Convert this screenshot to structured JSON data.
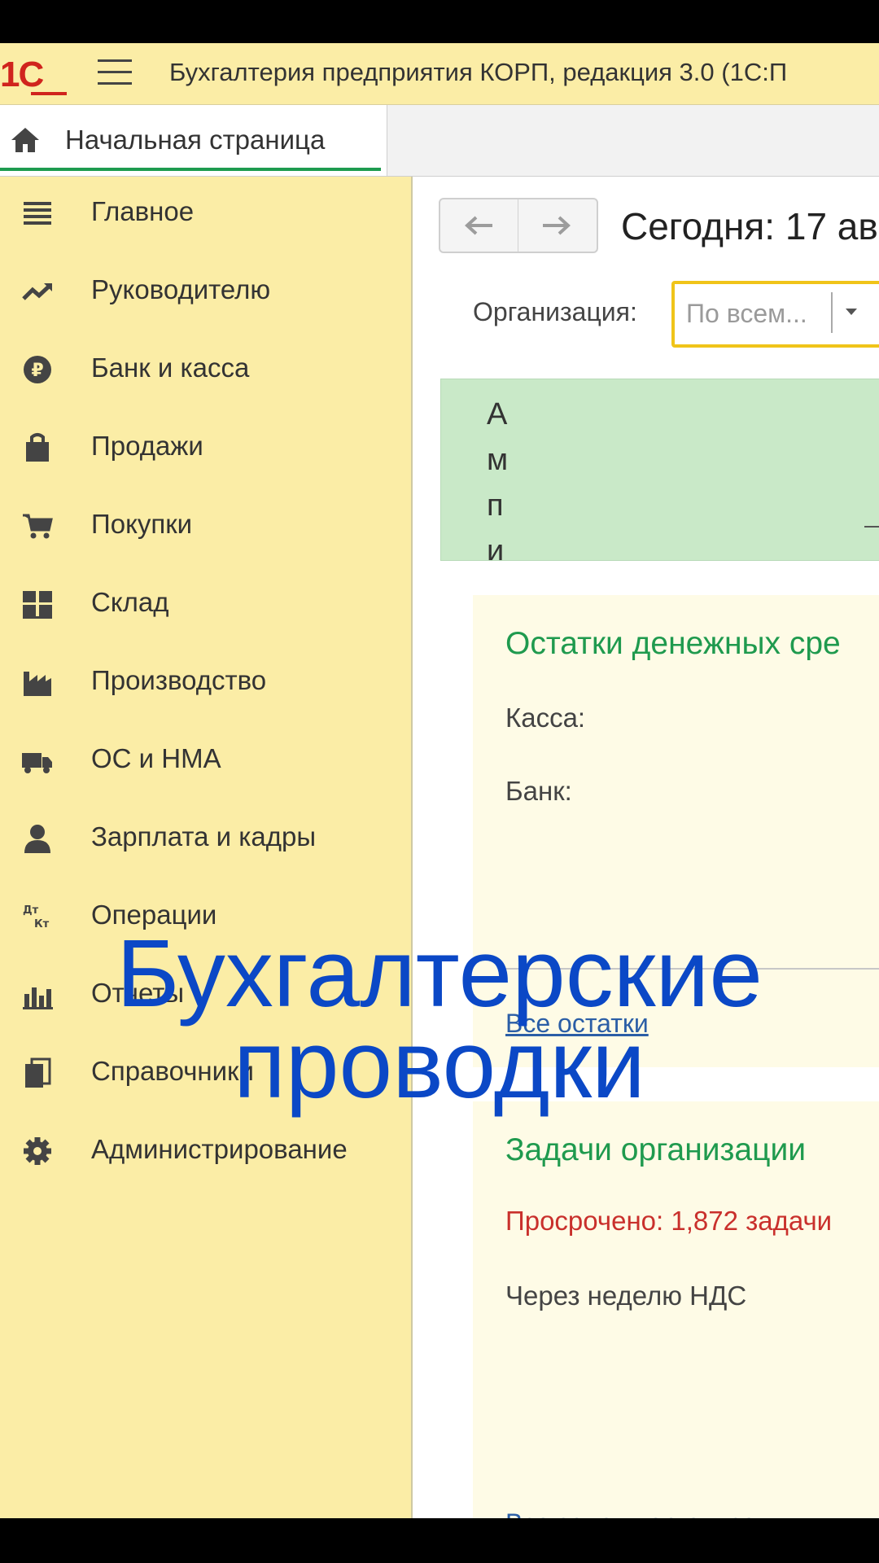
{
  "window": {
    "logo": "1С",
    "app_title": "Бухгалтерия предприятия КОРП, редакция 3.0  (1С:П"
  },
  "tabs": [
    {
      "label": "Начальная страница",
      "icon": "home-icon"
    }
  ],
  "sidebar": {
    "items": [
      {
        "label": "Главное",
        "icon": "menu-lines-icon"
      },
      {
        "label": "Руководителю",
        "icon": "trend-up-icon"
      },
      {
        "label": "Банк и касса",
        "icon": "ruble-coin-icon"
      },
      {
        "label": "Продажи",
        "icon": "shopping-bag-icon"
      },
      {
        "label": "Покупки",
        "icon": "cart-icon"
      },
      {
        "label": "Склад",
        "icon": "warehouse-grid-icon"
      },
      {
        "label": "Производство",
        "icon": "factory-icon"
      },
      {
        "label": "ОС и НМА",
        "icon": "truck-icon"
      },
      {
        "label": "Зарплата и кадры",
        "icon": "person-icon"
      },
      {
        "label": "Операции",
        "icon": "debit-credit-icon"
      },
      {
        "label": "Отчеты",
        "icon": "bar-chart-icon"
      },
      {
        "label": "Справочники",
        "icon": "books-icon"
      },
      {
        "label": "Администрирование",
        "icon": "gear-icon"
      }
    ]
  },
  "main": {
    "today_label": "Сегодня: 17 ав",
    "organization_label": "Организация:",
    "organization_value": "По всем...",
    "banner_chars": [
      "А",
      "м",
      "п",
      "и"
    ],
    "cash_card": {
      "title": "Остатки денежных сре",
      "cash_label": "Касса:",
      "bank_label": "Банк:",
      "link": "Все остатки"
    },
    "tasks_card": {
      "title": "Задачи организации",
      "overdue": "Просрочено: 1,872 задачи",
      "next_week": "Через неделю НДС",
      "link": "Все задачи организации"
    }
  },
  "overlay": {
    "line1": "Бухгалтерские",
    "line2": "проводки"
  },
  "colors": {
    "sidebar_bg": "#fbeda6",
    "accent_green": "#1e9b4f",
    "overdue_red": "#c9302c",
    "overlay_blue": "#0b48c6",
    "select_border": "#f0c419"
  }
}
